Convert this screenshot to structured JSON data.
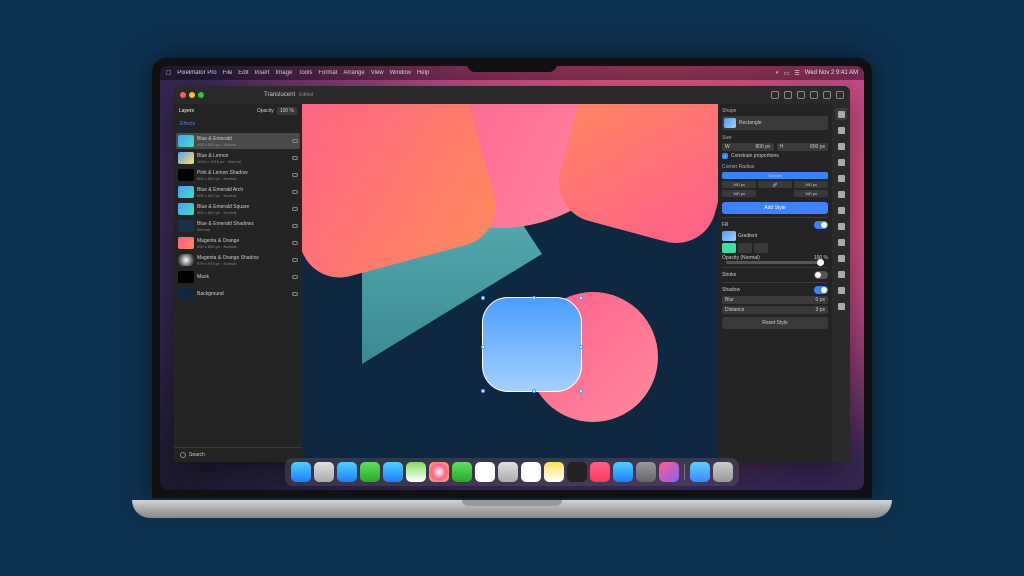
{
  "menubar": {
    "app": "Pixelmator Pro",
    "items": [
      "File",
      "Edit",
      "Insert",
      "Image",
      "Tools",
      "Format",
      "Arrange",
      "View",
      "Window",
      "Help"
    ],
    "datetime": "Wed Nov 2  9:41 AM"
  },
  "window": {
    "title": "Translucent",
    "subtitle": "Edited"
  },
  "layers_panel": {
    "title": "Layers",
    "opacity_label": "Opacity",
    "opacity_value": "100 %",
    "effects_label": "Effects",
    "search_placeholder": "Search",
    "items": [
      {
        "name": "Blue & Emerald",
        "sub": "800 x 800 px · Normal",
        "thumb": "be",
        "sel": true
      },
      {
        "name": "Blue & Lemon",
        "sub": "1016 x 1016 px · Normal",
        "thumb": "bl"
      },
      {
        "name": "Pink & Lemon Shadow",
        "sub": "800 x 800 px · Normal",
        "thumb": "pls"
      },
      {
        "name": "Blue & Emerald Arch",
        "sub": "800 x 600 px · Normal",
        "thumb": "bea"
      },
      {
        "name": "Blue & Emerald Square",
        "sub": "800 x 800 px · Normal",
        "thumb": "bes"
      },
      {
        "name": "Blue & Emerald Shadows",
        "sub": "Normal",
        "thumb": "bsh"
      },
      {
        "name": "Magenta & Orange",
        "sub": "800 x 800 px · Normal",
        "thumb": "mo"
      },
      {
        "name": "Magenta & Orange Shadow",
        "sub": "979 x 979 px · Normal",
        "thumb": "mos"
      },
      {
        "name": "Mask",
        "sub": "",
        "thumb": "mask"
      },
      {
        "name": "Background",
        "sub": "",
        "thumb": "bg"
      }
    ]
  },
  "inspector": {
    "shape_title": "Shape",
    "shape_name": "Rectangle",
    "size_title": "Size",
    "width": {
      "label": "W",
      "value": "800 px"
    },
    "height": {
      "label": "H",
      "value": "800 px"
    },
    "constrain": "Constrain proportions",
    "corner_title": "Corner Radius",
    "corner_mode": "Smooth",
    "corner_values": [
      "160 px",
      "160 px",
      "160 px",
      "160 px"
    ],
    "add_style": "Add Style",
    "fill": {
      "title": "Fill",
      "type": "Gradient",
      "opacity_label": "Opacity (Normal)",
      "opacity": "100 %"
    },
    "stroke": {
      "title": "Stroke"
    },
    "shadow": {
      "title": "Shadow",
      "blur_label": "Blur",
      "blur": "0 px",
      "distance_label": "Distance",
      "distance": "3 px"
    },
    "reset": "Reset Style"
  },
  "tools": [
    "arrange",
    "style",
    "crop",
    "color",
    "retouch",
    "paint",
    "erase",
    "shape",
    "text",
    "pen",
    "zoom",
    "hand",
    "export"
  ],
  "dock": {
    "apps": [
      {
        "name": "finder",
        "color": "linear-gradient(180deg,#4dd0ff,#1a7fff)"
      },
      {
        "name": "launchpad",
        "color": "linear-gradient(180deg,#e0e0e0,#aaa)"
      },
      {
        "name": "safari",
        "color": "linear-gradient(180deg,#4dd0ff,#1a7fff)"
      },
      {
        "name": "messages",
        "color": "linear-gradient(180deg,#5de05a,#2aa82a)"
      },
      {
        "name": "mail",
        "color": "linear-gradient(180deg,#4dd0ff,#1a7fff)"
      },
      {
        "name": "maps",
        "color": "linear-gradient(180deg,#7de05a,#fff)"
      },
      {
        "name": "photos",
        "color": "radial-gradient(circle,#fff,#ff5e8a,#ffcc5a)"
      },
      {
        "name": "facetime",
        "color": "linear-gradient(180deg,#5de05a,#2aa82a)"
      },
      {
        "name": "calendar",
        "color": "#fff"
      },
      {
        "name": "contacts",
        "color": "linear-gradient(180deg,#e0e0e0,#aaa)"
      },
      {
        "name": "reminders",
        "color": "#fff"
      },
      {
        "name": "notes",
        "color": "linear-gradient(180deg,#ffe05a,#fff)"
      },
      {
        "name": "tv",
        "color": "#222"
      },
      {
        "name": "music",
        "color": "linear-gradient(180deg,#ff5e8a,#ff3a5a)"
      },
      {
        "name": "appstore",
        "color": "linear-gradient(180deg,#4dd0ff,#1a7fff)"
      },
      {
        "name": "settings",
        "color": "linear-gradient(180deg,#999,#666)"
      },
      {
        "name": "pixelmator",
        "color": "linear-gradient(135deg,#ff5e8a,#8a5eff)"
      }
    ],
    "right": [
      {
        "name": "downloads",
        "color": "linear-gradient(180deg,#5dd0ff,#3a8aff)"
      },
      {
        "name": "trash",
        "color": "linear-gradient(180deg,#ccc,#999)"
      }
    ]
  }
}
